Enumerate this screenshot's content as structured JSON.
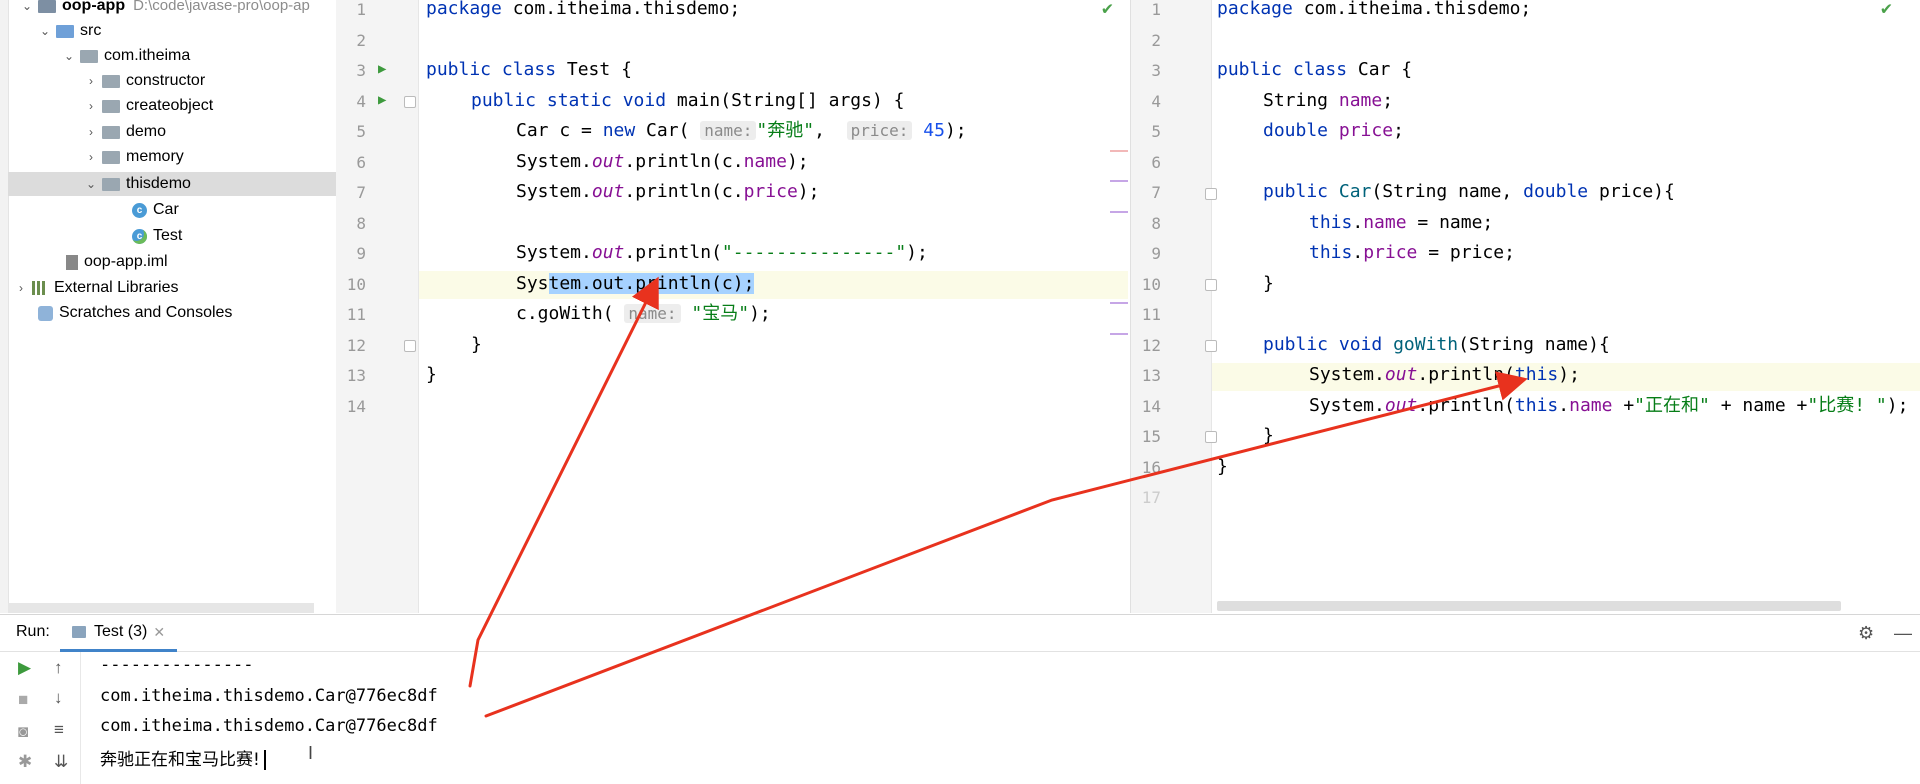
{
  "project_tree": {
    "root_label": "oop-app",
    "root_path": "D:\\code\\javase-pro\\oop-ap",
    "src": "src",
    "package": "com.itheima",
    "folders": [
      "constructor",
      "createobject",
      "demo",
      "memory",
      "thisdemo"
    ],
    "classes": [
      "Car",
      "Test"
    ],
    "iml": "oop-app.iml",
    "external_libraries": "External Libraries",
    "scratches": "Scratches and Consoles"
  },
  "editor_test": {
    "line_numbers": [
      "1",
      "2",
      "3",
      "4",
      "5",
      "6",
      "7",
      "8",
      "9",
      "10",
      "11",
      "12",
      "13",
      "14"
    ],
    "package_kw": "package",
    "package_name": " com.itheima.thisdemo;",
    "class_decl_kw": "public class",
    "class_name": " Test {",
    "main_kw": "public static void",
    "main_sig": " main(String[] args) {",
    "line5_pre": "Car c = ",
    "line5_new": "new",
    "line5_mid": " Car(",
    "hint_name": "name:",
    "str_benchi": "\"奔驰\"",
    "comma": ",",
    "hint_price": "price:",
    "num_45": "45",
    "line5_end": ");",
    "sys": "System.",
    "out": "out",
    "println_c_name_a": ".println(c.",
    "name_field": "name",
    "close_paren": ");",
    "println_c_price_a": ".println(c.",
    "price_field": "price",
    "println_open": ".println(",
    "dashes_str": "\"---------------\"",
    "line10_pre": "Sys",
    "line10_sel": "tem.out.println(c);",
    "line11_pre": "c.goWith(",
    "hint_name2": "name:",
    "str_baoma": "\"宝马\"",
    "line11_end": ");",
    "brace_close": "}",
    "brace_close_outer": "}"
  },
  "editor_car": {
    "line_numbers": [
      "1",
      "2",
      "3",
      "4",
      "5",
      "6",
      "7",
      "8",
      "9",
      "10",
      "11",
      "12",
      "13",
      "14",
      "15",
      "16",
      "17"
    ],
    "package_kw": "package",
    "package_name": " com.itheima.thisdemo;",
    "class_kw": "public class",
    "class_name": " Car {",
    "string_type": "String ",
    "name_field": "name",
    "semi": ";",
    "double_kw": "double",
    "price_field": "price",
    "ctor_kw": "public",
    "ctor_name": "Car",
    "ctor_sig_a": "(String name, ",
    "ctor_double": "double",
    "ctor_sig_b": " price){",
    "this_kw": "this",
    "assign_name": " = name;",
    "assign_price": " = price;",
    "brace": "}",
    "gowith_kw": "public void",
    "gowith_name": "goWith",
    "gowith_sig": "(String name){",
    "sys": "System.",
    "out": "out",
    "println_open": ".println(",
    "this_close": ");",
    "plus": " +",
    "str_zhengzaihe": "\"正在和\"",
    "plus_name_plus": " + name +",
    "str_bisai": "\"比赛! \"",
    "end_semi": ");",
    "brace_outer": "}"
  },
  "run_panel": {
    "label": "Run:",
    "tab_label": "Test (3)",
    "output_lines": [
      "---------------",
      "com.itheima.thisdemo.Car@776ec8df",
      "com.itheima.thisdemo.Car@776ec8df",
      "奔驰正在和宝马比赛!"
    ]
  },
  "colors": {
    "keyword": "#0033b3",
    "field": "#871094",
    "string": "#067d17",
    "number": "#1750eb",
    "selection": "#a6d2ff",
    "arrow": "#e8321e",
    "tab_underline": "#4083c9"
  }
}
